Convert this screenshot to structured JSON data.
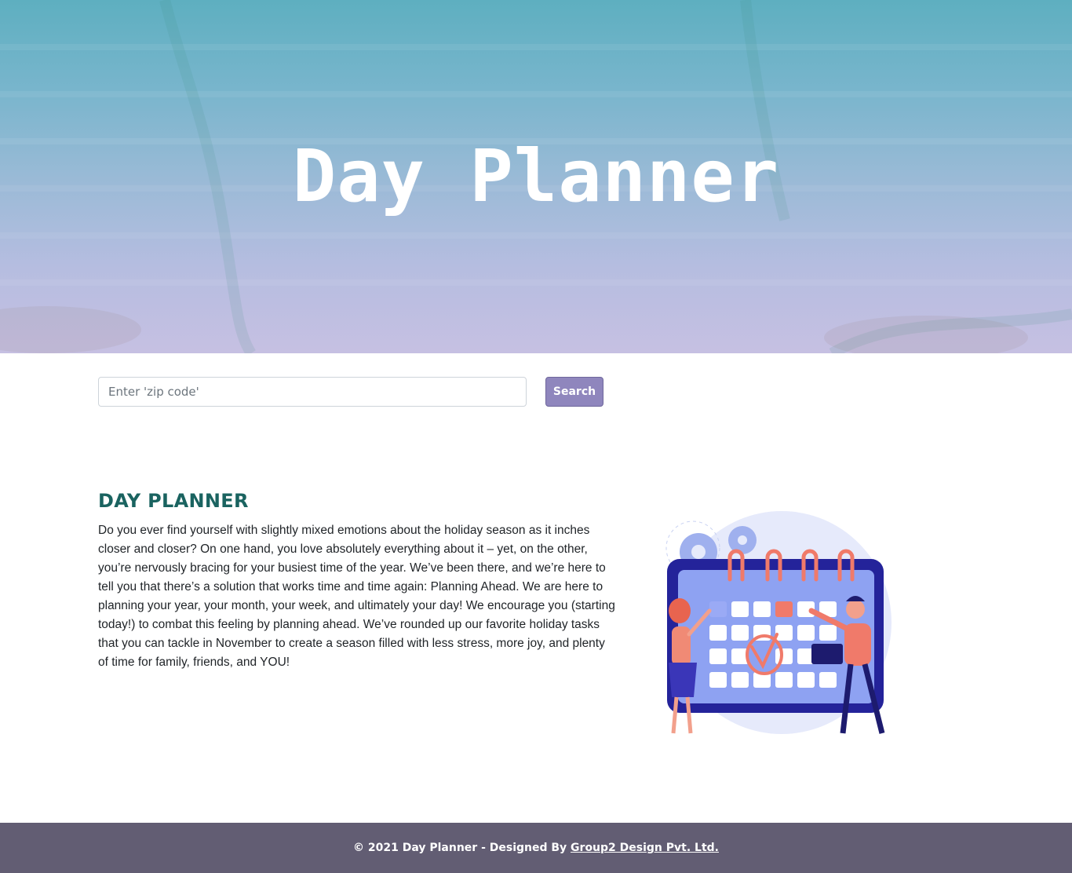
{
  "hero": {
    "title": "Day Planner"
  },
  "search": {
    "placeholder": "Enter 'zip code'",
    "button_label": "Search"
  },
  "content": {
    "heading": "DAY PLANNER",
    "paragraph": "Do you ever find yourself with slightly mixed emotions about the holiday season as it inches closer and closer? On one hand, you love absolutely everything about it – yet, on the other, you’re nervously bracing for your busiest time of the year. We’ve been there, and we’re here to tell you that there’s a solution that works time and time again: Planning Ahead. We are here to planning your year, your month, your week, and ultimately your day! We encourage you (starting today!) to combat this feeling by planning ahead. We’ve rounded up our favorite holiday tasks that you can tackle in November to create a season filled with less stress, more joy, and plenty of time for family, friends, and YOU!",
    "illustration_icon": "calendar-planning-illustration"
  },
  "footer": {
    "prefix": "© 2021 Day Planner - Designed By ",
    "link_text": "Group2 Design Pvt. Ltd."
  },
  "colors": {
    "button": "#8f86bd",
    "heading": "#1a6360",
    "footer": "#625d73"
  }
}
